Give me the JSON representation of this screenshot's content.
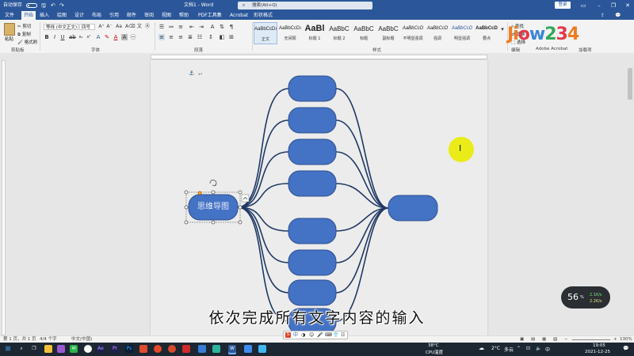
{
  "titlebar": {
    "autosave_label": "自动保存",
    "document_title": "文档1 - Word",
    "search_placeholder": "搜索(Alt+Q)",
    "login_label": "登录"
  },
  "tabs": [
    {
      "label": "文件"
    },
    {
      "label": "开始"
    },
    {
      "label": "插入"
    },
    {
      "label": "绘图"
    },
    {
      "label": "设计"
    },
    {
      "label": "布局"
    },
    {
      "label": "引用"
    },
    {
      "label": "邮件"
    },
    {
      "label": "审阅"
    },
    {
      "label": "视图"
    },
    {
      "label": "帮助"
    },
    {
      "label": "PDF工具集"
    },
    {
      "label": "Acrobat"
    },
    {
      "label": "形状格式"
    }
  ],
  "ribbon": {
    "clipboard": {
      "paste": "粘贴",
      "cut": "剪切",
      "copy": "复制",
      "format_painter": "格式刷",
      "group": "剪贴板"
    },
    "font": {
      "font_name": "等线 (中文正文)",
      "font_size": "四号",
      "group": "字体"
    },
    "paragraph": {
      "group": "段落"
    },
    "styles": {
      "group": "样式",
      "items": [
        {
          "preview": "AaBbCcDı",
          "name": "正文"
        },
        {
          "preview": "AaBbCcDı",
          "name": "无间隔"
        },
        {
          "preview": "AaBl",
          "name": "标题 1"
        },
        {
          "preview": "AaBbC",
          "name": "标题 2"
        },
        {
          "preview": "AaBbC",
          "name": "标题"
        },
        {
          "preview": "AaBbC",
          "name": "副标题"
        },
        {
          "preview": "AaBbCcD",
          "name": "不明显强调"
        },
        {
          "preview": "AaBbCcD",
          "name": "强调"
        },
        {
          "preview": "AaBbCcD",
          "name": "明显强调"
        },
        {
          "preview": "AaBbCcD",
          "name": "要点"
        }
      ]
    },
    "editing": {
      "find": "查找",
      "replace": "替换",
      "select": "选择",
      "group": "编辑"
    },
    "extra_groups": [
      "Adobe Acrobat",
      "加载项"
    ]
  },
  "logo_text": "Jiow234",
  "document": {
    "mindmap": {
      "center_label": "思维导图",
      "node_fill": "#4472c4",
      "node_border": "#2f528f",
      "line_color": "#1f3864"
    }
  },
  "statusbar": {
    "page": "第 1 页，共 1 页",
    "words": "4/4 个字",
    "language": "中文(中国)",
    "zoom": "130%"
  },
  "subtitle": "依次完成所有文字内容的输入",
  "cpu_widget": {
    "percent": "56",
    "stat1": "2.1K/s",
    "stat2": "2.2K/s"
  },
  "taskbar": {
    "weather_temp": "38°C",
    "weather_label": "CPU温度",
    "temperature": "2°C",
    "weather": "多云",
    "time": "19:05",
    "date": "2021-12-25"
  }
}
